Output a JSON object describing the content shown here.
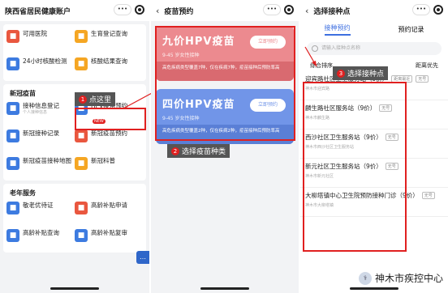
{
  "panel1": {
    "title": "陕西省居民健康账户",
    "more": "•••",
    "top_items": [
      {
        "label": "可用医院",
        "sub": "",
        "color": "#e9573f",
        "icon": "hospital-icon"
      },
      {
        "label": "生育登记查询",
        "sub": "",
        "color": "#f5a623",
        "icon": "baby-icon"
      },
      {
        "label": "24小时核酸检测",
        "sub": "",
        "color": "#3d7be0",
        "icon": "test-tube-icon"
      },
      {
        "label": "核酸结果查询",
        "sub": "",
        "color": "#f5a623",
        "icon": "result-icon"
      }
    ],
    "section_vaccine": "新冠疫苗",
    "vaccine_items": [
      {
        "label": "接种信息登记",
        "sub": "个人接种信息",
        "color": "#3d7be0",
        "icon": "register-icon"
      },
      {
        "label": "HPV疫苗预约",
        "sub": "",
        "badge": "NEW",
        "color": "#3d7be0",
        "icon": "hpv-icon"
      },
      {
        "label": "新冠接种记录",
        "sub": "",
        "color": "#3d7be0",
        "icon": "record-icon"
      },
      {
        "label": "新冠疫苗预约",
        "sub": "",
        "color": "#e9573f",
        "icon": "syringe-icon"
      },
      {
        "label": "新冠疫苗接种地图",
        "sub": "",
        "color": "#3d7be0",
        "icon": "map-icon"
      },
      {
        "label": "新冠科普",
        "sub": "",
        "color": "#f5a623",
        "icon": "science-icon"
      }
    ],
    "section_senior": "老年服务",
    "senior_items": [
      {
        "label": "敬老优待证",
        "sub": "",
        "color": "#3d7be0",
        "icon": "card-icon"
      },
      {
        "label": "高龄补贴申请",
        "sub": "",
        "color": "#e9573f",
        "icon": "apply-icon"
      },
      {
        "label": "高龄补贴查询",
        "sub": "",
        "color": "#3d7be0",
        "icon": "search-doc-icon"
      },
      {
        "label": "高龄补贴复审",
        "sub": "",
        "color": "#3d7be0",
        "icon": "review-icon"
      }
    ],
    "callout": "点这里",
    "callout_num": "1"
  },
  "panel2": {
    "title": "疫苗预约",
    "more": "•••",
    "cards": [
      {
        "title": "九价HPV疫苗",
        "age": "9-45 岁女性接种",
        "btn": "立即预约",
        "note": "高危疾病类型覆盖7种，仅在疾病7种，疫苗接种后预防率高",
        "color": "#ec8a8f",
        "note_color": "#d96a70"
      },
      {
        "title": "四价HPV疫苗",
        "age": "9-45 岁女性接种",
        "btn": "立即预约",
        "note": "高危疾病类型覆盖2种，仅在疾病2种，疫苗接种后预防率高",
        "color": "#7195e8",
        "note_color": "#5a7fd6"
      }
    ],
    "callout": "选择疫苗种类",
    "callout_num": "2"
  },
  "panel3": {
    "title": "选择接种点",
    "more": "•••",
    "tabs": [
      "接种预约",
      "预约记录"
    ],
    "search_placeholder": "请输入接种点名称",
    "sort_left": "综合排序",
    "sort_right": "距离优先",
    "callout": "选择接种点",
    "callout_num": "3",
    "sites": [
      {
        "name": "迎宾路社区卫生服务站（9价）",
        "tag": "距离最近",
        "tag2": "无号",
        "addr": "神木市迎宾路",
        "dist": ""
      },
      {
        "name": "麟生路社区服务站（9价）",
        "tag": "无号",
        "addr": "神木市麟生路",
        "dist": ""
      },
      {
        "name": "西沙社区卫生服务站（9价）",
        "tag": "无号",
        "addr": "神木市西沙社区卫生服务站",
        "dist": ""
      },
      {
        "name": "新元社区卫生服务站（9价）",
        "tag": "无号",
        "addr": "神木市新元社区",
        "dist": ""
      },
      {
        "name": "大柳塔镇中心卫生院预防接种门诊（9价）",
        "tag": "无号",
        "addr": "神木市大柳塔镇",
        "dist": ""
      }
    ]
  },
  "watermark": "神木市疾控中心"
}
